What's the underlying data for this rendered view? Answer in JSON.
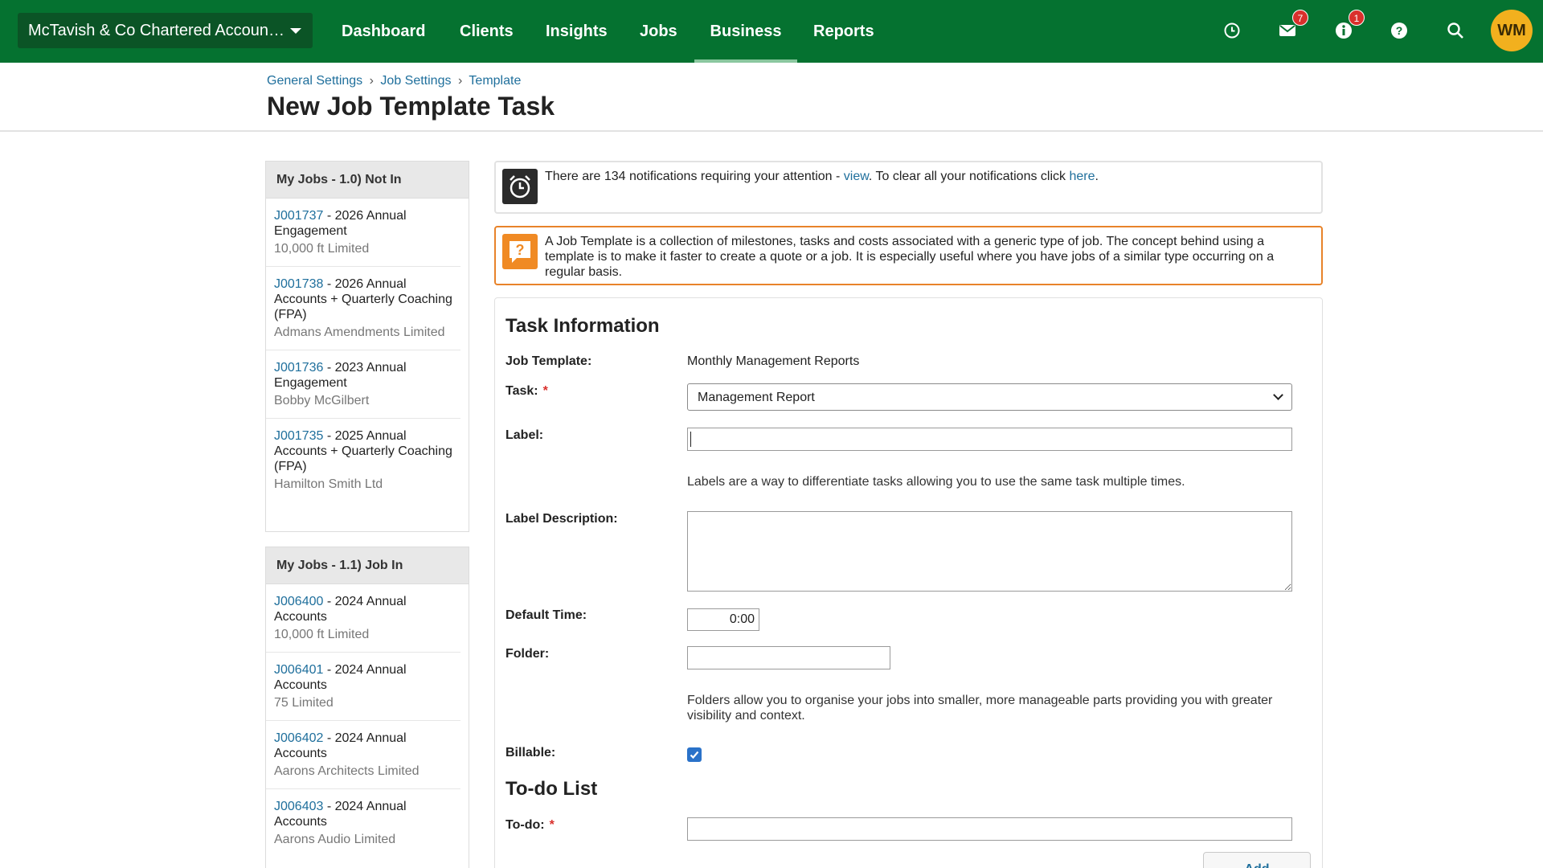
{
  "org": {
    "name": "McTavish & Co Chartered Accoun…"
  },
  "nav": {
    "items": [
      {
        "label": "Dashboard"
      },
      {
        "label": "Clients"
      },
      {
        "label": "Insights"
      },
      {
        "label": "Jobs"
      },
      {
        "label": "Business"
      },
      {
        "label": "Reports"
      }
    ],
    "active": "Business",
    "mail_badge": "7",
    "info_badge": "1",
    "avatar_initials": "WM"
  },
  "breadcrumb": [
    "General Settings",
    "Job Settings",
    "Template"
  ],
  "page_title": "New Job Template Task",
  "sidebar": {
    "panels": [
      {
        "title": "My Jobs - 1.0) Not In",
        "items": [
          {
            "code": "J001737",
            "desc": " - 2026 Annual Engagement",
            "client": "10,000 ft Limited"
          },
          {
            "code": "J001738",
            "desc": " - 2026 Annual Accounts + Quarterly Coaching (FPA)",
            "client": "Admans Amendments Limited"
          },
          {
            "code": "J001736",
            "desc": " - 2023 Annual Engagement",
            "client": "Bobby McGilbert"
          },
          {
            "code": "J001735",
            "desc": " - 2025 Annual Accounts + Quarterly Coaching (FPA)",
            "client": "Hamilton Smith Ltd"
          }
        ]
      },
      {
        "title": "My Jobs - 1.1) Job In",
        "items": [
          {
            "code": "J006400",
            "desc": " - 2024 Annual Accounts",
            "client": "10,000 ft Limited"
          },
          {
            "code": "J006401",
            "desc": " - 2024 Annual Accounts",
            "client": "75 Limited"
          },
          {
            "code": "J006402",
            "desc": " - 2024 Annual Accounts",
            "client": "Aarons Architects Limited"
          },
          {
            "code": "J006403",
            "desc": " - 2024 Annual Accounts",
            "client": "Aarons Audio Limited"
          }
        ]
      }
    ]
  },
  "notifications": {
    "text_before": "There are 134 notifications requiring your attention - ",
    "view_link": "view",
    "text_middle": ". To clear all your notifications click ",
    "here_link": "here",
    "text_after": "."
  },
  "info_notice": {
    "text": "A Job Template is a collection of milestones, tasks and costs associated with a generic type of job. The concept behind using a template is to make it faster to create a quote or a job. It is especially useful where you have jobs of a similar type occurring on a regular basis."
  },
  "form": {
    "section_title": "Task Information",
    "job_template_label": "Job Template:",
    "job_template_value": "Monthly Management Reports",
    "task_label": "Task:",
    "task_value": "Management Report",
    "required_mark": "*",
    "label_label": "Label:",
    "label_value": "",
    "label_help": "Labels are a way to differentiate tasks allowing you to use the same task multiple times.",
    "label_desc_label": "Label Description:",
    "label_desc_value": "",
    "default_time_label": "Default Time:",
    "default_time_value": "0:00",
    "folder_label": "Folder:",
    "folder_value": "",
    "folder_help": "Folders allow you to organise your jobs into smaller, more manageable parts providing you with greater visibility and context.",
    "billable_label": "Billable:",
    "billable_checked": true,
    "todo_section_title": "To-do List",
    "todo_label": "To-do:",
    "todo_value": "",
    "add_button": "Add"
  }
}
